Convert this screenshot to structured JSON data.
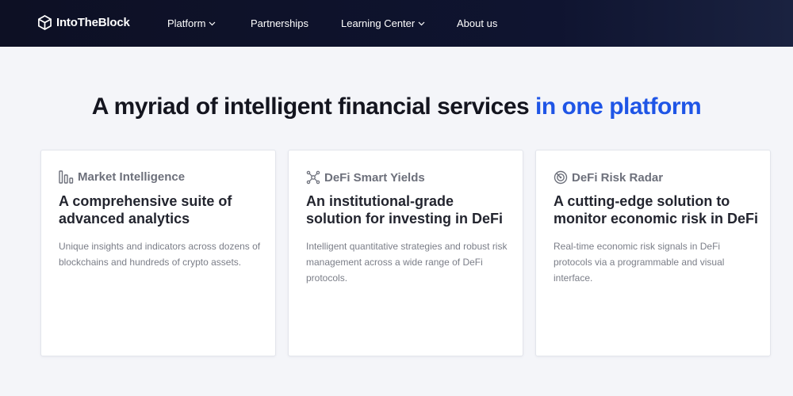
{
  "nav": {
    "brand": "IntoTheBlock",
    "items": [
      {
        "label": "Platform",
        "dropdown": true
      },
      {
        "label": "Partnerships",
        "dropdown": false
      },
      {
        "label": "Learning Center",
        "dropdown": true
      },
      {
        "label": "About us",
        "dropdown": false
      }
    ]
  },
  "headline": {
    "main": "A myriad of intelligent financial services",
    "accent": "in one platform",
    "accent_color": "#1f55e6"
  },
  "cards": [
    {
      "icon": "bar-chart-icon",
      "category": "Market Intelligence",
      "title": "A comprehensive suite of advanced analytics",
      "description": "Unique insights and indicators across dozens of blockchains and hundreds of crypto assets."
    },
    {
      "icon": "network-icon",
      "category": "DeFi Smart Yields",
      "title": "An institutional-grade solution for investing in DeFi",
      "description": "Intelligent quantitative strategies and robust risk management across a wide range of DeFi protocols."
    },
    {
      "icon": "radar-icon",
      "category": "DeFi Risk Radar",
      "title": "A cutting-edge solution to monitor economic risk in DeFi",
      "description": "Real-time economic risk signals in DeFi protocols via a programmable and visual interface."
    }
  ]
}
